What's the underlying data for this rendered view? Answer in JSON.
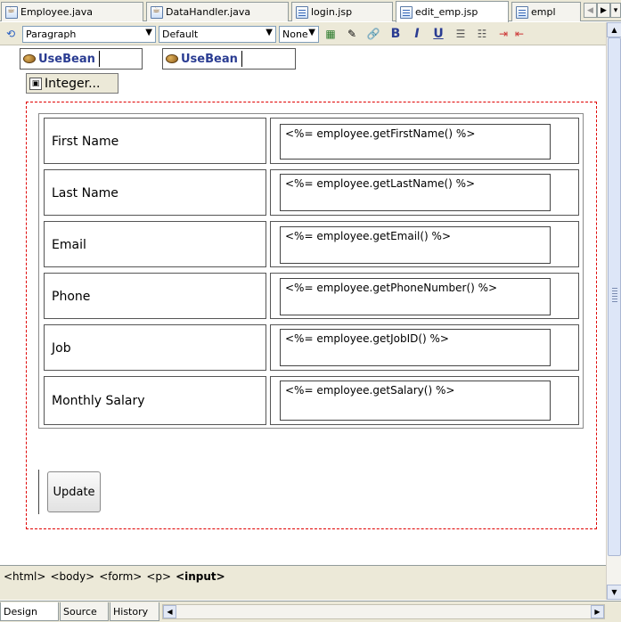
{
  "tabs": [
    {
      "label": "Employee.java",
      "icon": "java-file-icon",
      "active": false
    },
    {
      "label": "DataHandler.java",
      "icon": "java-file-icon",
      "active": false
    },
    {
      "label": "login.jsp",
      "icon": "jsp-file-icon",
      "active": false
    },
    {
      "label": "edit_emp.jsp",
      "icon": "jsp-file-icon",
      "active": true
    },
    {
      "label": "empl",
      "icon": "jsp-file-icon",
      "active": false
    }
  ],
  "toolbar": {
    "style_value": "Paragraph",
    "font_value": "Default",
    "size_value": "None",
    "bold": "B",
    "italic": "I",
    "underline": "U"
  },
  "design": {
    "usebean_1": "UseBean",
    "usebean_2": "UseBean",
    "integer_label": "Integer...",
    "rows": [
      {
        "label": "First Name",
        "expr": "<%= employee.getFirstName() %>"
      },
      {
        "label": "Last Name",
        "expr": "<%= employee.getLastName() %>"
      },
      {
        "label": "Email",
        "expr": "<%= employee.getEmail() %>"
      },
      {
        "label": "Phone",
        "expr": "<%= employee.getPhoneNumber() %>"
      },
      {
        "label": "Job",
        "expr": "<%= employee.getJobID() %>"
      },
      {
        "label": "Monthly Salary",
        "expr": "<%= employee.getSalary() %>"
      }
    ],
    "update_label": "Update"
  },
  "breadcrumb": {
    "items": [
      "<html>",
      "<body>",
      "<form>",
      "<p>"
    ],
    "current": "<input>"
  },
  "bottom_tabs": [
    {
      "label": "Design",
      "active": true
    },
    {
      "label": "Source",
      "active": false
    },
    {
      "label": "History",
      "active": false
    }
  ],
  "colors": {
    "chrome": "#ece9d8",
    "form_border": "#e00000",
    "usebean_text": "#2a3c92"
  }
}
